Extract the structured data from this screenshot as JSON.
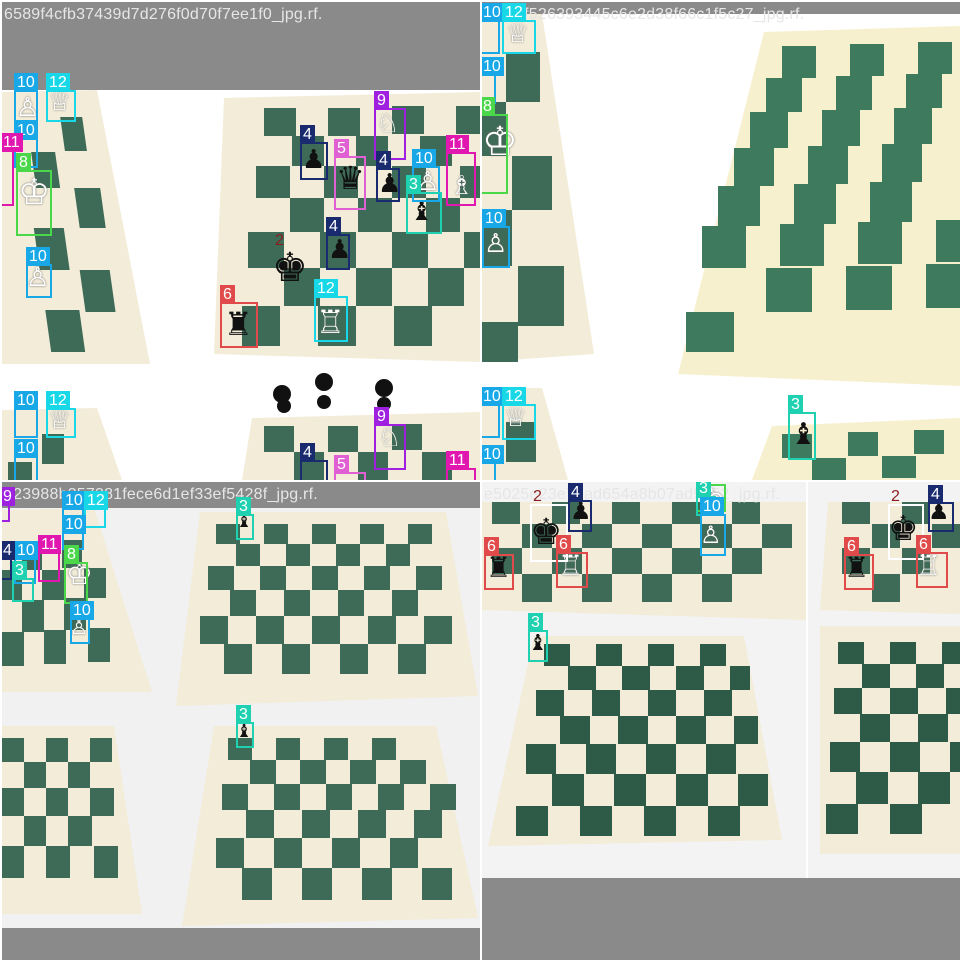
{
  "tiles": [
    {
      "filename": "6589f4cfb37439d7d276f0d70f7ee1f0_jpg.rf."
    },
    {
      "filename": "f9c5ef526393445c6e2d38f66c1f5c27_jpg.rf."
    },
    {
      "filename": "123988b357381fece6d1ef33ef5428f_jpg.rf."
    },
    {
      "filename": "e5025e23e7ead654a8b07ad9d52_jpg.rf."
    }
  ],
  "classes": {
    "2": {
      "color": "#8b1c1c"
    },
    "3": {
      "color": "#1fd1b0"
    },
    "4": {
      "color": "#1a2a6e"
    },
    "5": {
      "color": "#e05fd2"
    },
    "6": {
      "color": "#e04a4a"
    },
    "8": {
      "color": "#4ad84a"
    },
    "9": {
      "color": "#a020e0"
    },
    "10": {
      "color": "#18a8e8"
    },
    "11": {
      "color": "#e018b0"
    },
    "12": {
      "color": "#18d8e8"
    }
  },
  "labels": {
    "t1": [
      "10",
      "12",
      "10",
      "11",
      "8",
      "10",
      "4",
      "5",
      "9",
      "4",
      "10",
      "11",
      "3",
      "4",
      "2",
      "6",
      "12",
      "10",
      "12",
      "10",
      "4",
      "5",
      "9",
      "11"
    ],
    "t2": [
      "10",
      "12",
      "10",
      "8",
      "10",
      "10",
      "12",
      "10",
      "3"
    ],
    "t3": [
      "9",
      "10",
      "12",
      "10",
      "10",
      "4",
      "11",
      "8",
      "3",
      "10",
      "3",
      "3"
    ],
    "t4": [
      "2",
      "4",
      "6",
      "6",
      "8",
      "3",
      "10",
      "2",
      "4",
      "6",
      "6",
      "3"
    ]
  }
}
